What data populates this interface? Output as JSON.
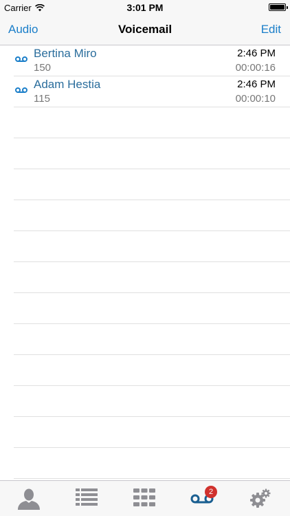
{
  "status_bar": {
    "carrier": "Carrier",
    "time": "3:01 PM"
  },
  "nav": {
    "left_label": "Audio",
    "title": "Voicemail",
    "right_label": "Edit"
  },
  "voicemails": [
    {
      "name": "Bertina Miro",
      "extension": "150",
      "time": "2:46 PM",
      "duration": "00:00:16"
    },
    {
      "name": "Adam Hestia",
      "extension": "115",
      "time": "2:46 PM",
      "duration": "00:00:10"
    }
  ],
  "tab_bar": {
    "tabs": [
      {
        "icon": "person-icon",
        "selected": false
      },
      {
        "icon": "list-icon",
        "selected": false
      },
      {
        "icon": "keypad-icon",
        "selected": false
      },
      {
        "icon": "voicemail-icon",
        "selected": true,
        "badge": "2"
      },
      {
        "icon": "gears-icon",
        "selected": false
      }
    ]
  },
  "colors": {
    "accent": "#1a7ec9",
    "name_text": "#2a6d9c",
    "badge": "#d0312d",
    "tab_inactive": "#8e8e93"
  }
}
